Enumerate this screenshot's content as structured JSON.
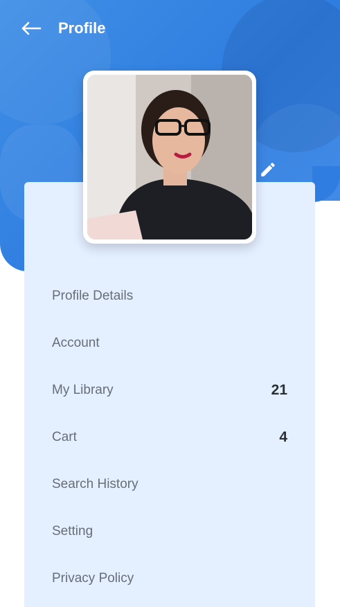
{
  "header": {
    "title": "Profile",
    "back_icon": "arrow-left-icon"
  },
  "profile": {
    "avatar_alt": "",
    "edit_icon": "pencil-icon"
  },
  "menu": {
    "items": [
      {
        "label": "Profile Details",
        "count": ""
      },
      {
        "label": "Account",
        "count": ""
      },
      {
        "label": "My Library",
        "count": "21"
      },
      {
        "label": "Cart",
        "count": "4"
      },
      {
        "label": "Search History",
        "count": ""
      },
      {
        "label": "Setting",
        "count": ""
      },
      {
        "label": "Privacy Policy",
        "count": ""
      }
    ]
  },
  "colors": {
    "primary": "#2f7de0",
    "card_bg": "#e4efff",
    "label_text": "#666e78",
    "count_text": "#2a2f36"
  }
}
